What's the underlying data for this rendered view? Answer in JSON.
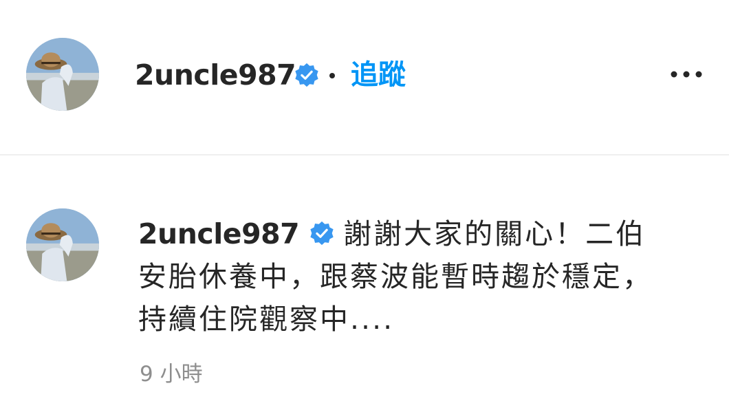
{
  "header": {
    "username": "2uncle987",
    "verified_icon": "verified-badge-icon",
    "separator": "•",
    "follow_label": "追蹤",
    "more_icon": "more-options-icon"
  },
  "comment": {
    "username": "2uncle987",
    "verified_icon": "verified-badge-icon",
    "text": "謝謝大家的關心！二伯安胎休養中，跟蔡波能暫時趨於穩定，持續住院觀察中....",
    "timestamp": "9 小時"
  },
  "colors": {
    "text": "#262626",
    "link": "#0095f6",
    "verified": "#3897f0",
    "muted": "#8e8e8e",
    "divider": "#efefef"
  }
}
